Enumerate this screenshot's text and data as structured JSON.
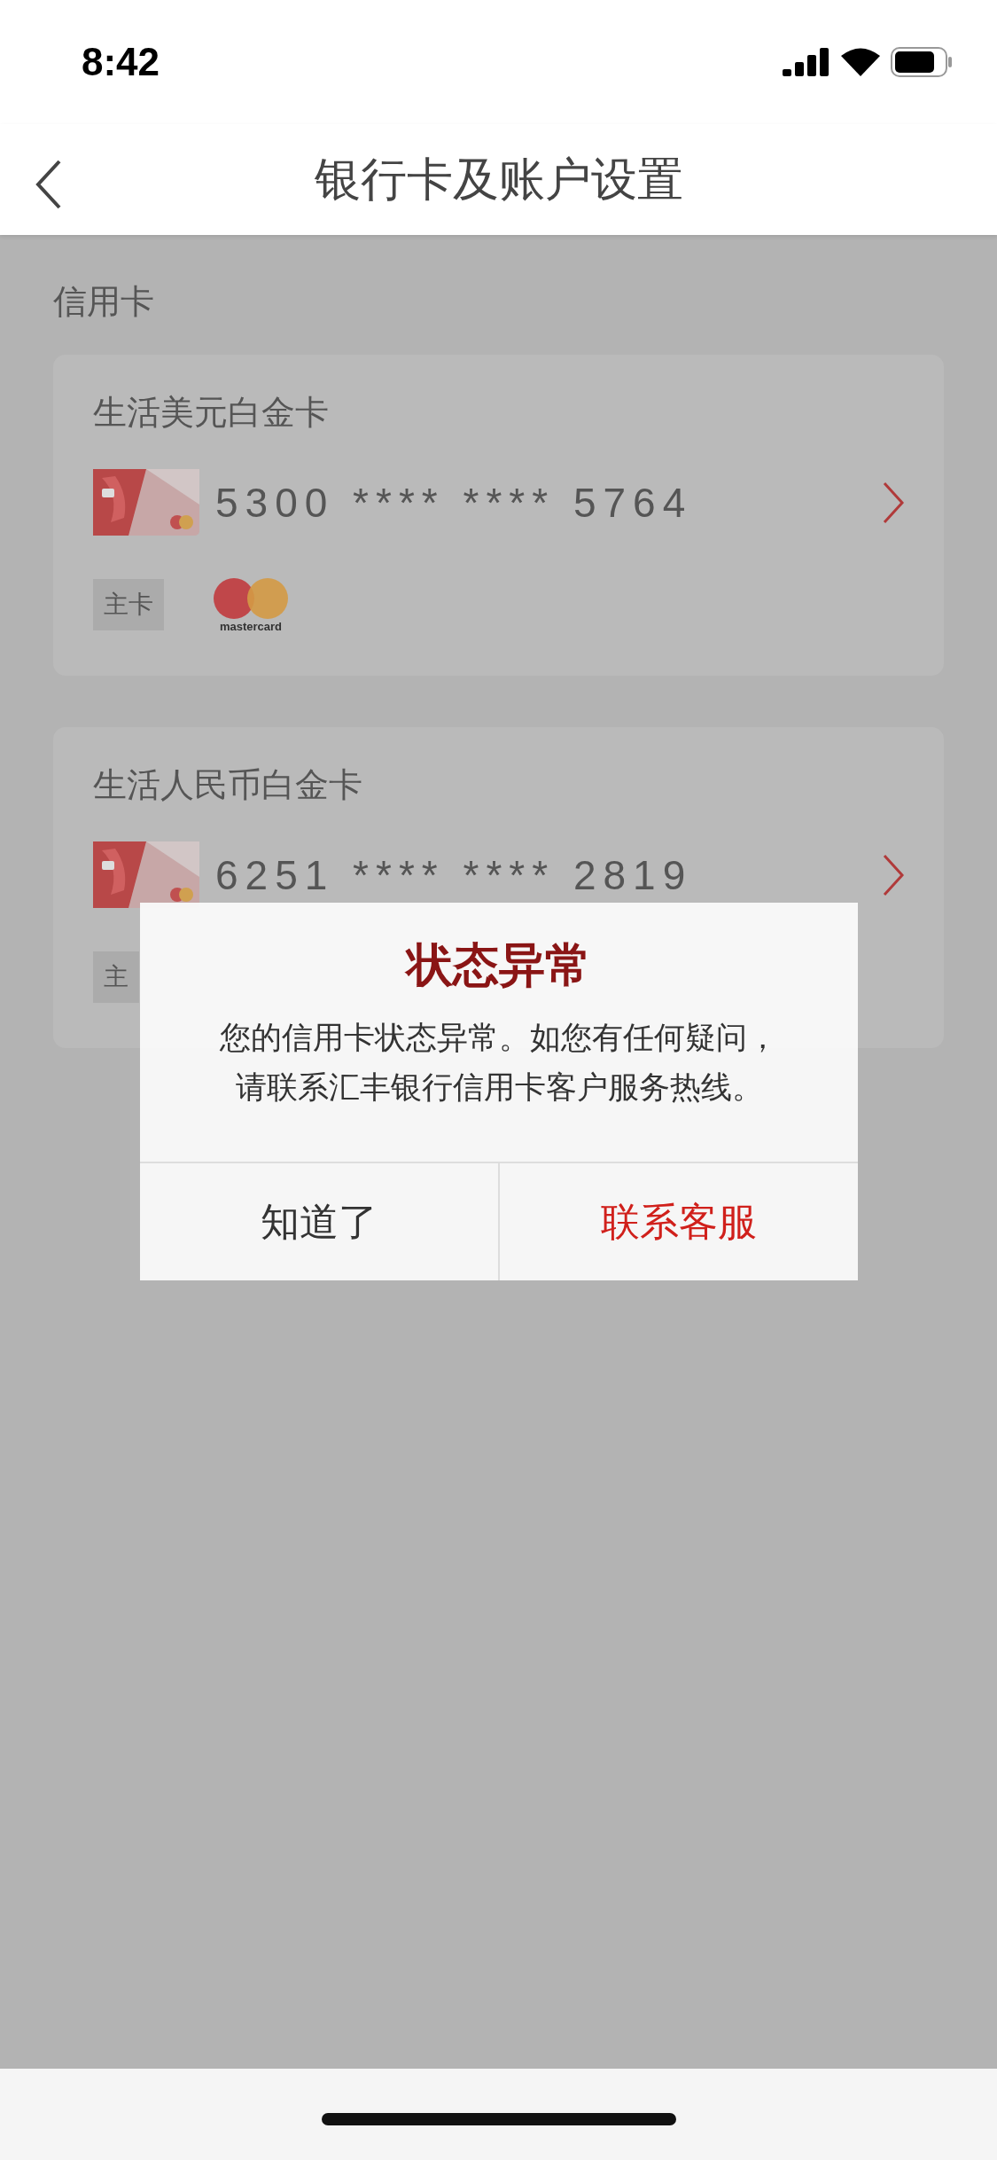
{
  "status_bar": {
    "time": "8:42"
  },
  "nav": {
    "title": "银行卡及账户设置"
  },
  "section": {
    "title": "信用卡"
  },
  "cards": [
    {
      "name": "生活美元白金卡",
      "number": "5300 **** **** 5764",
      "tag": "主卡",
      "network_logo": "mastercard"
    },
    {
      "name": "生活人民币白金卡",
      "number": "6251 **** **** 2819",
      "tag": "主"
    }
  ],
  "dialog": {
    "title": "状态异常",
    "message": [
      "您的信用卡状态异常。如您有任何疑问，",
      "请联系汇丰银行信用卡客户服务热线。"
    ],
    "buttons": [
      {
        "label": "知道了",
        "kind": "plain"
      },
      {
        "label": "联系客服",
        "kind": "primary"
      }
    ]
  }
}
